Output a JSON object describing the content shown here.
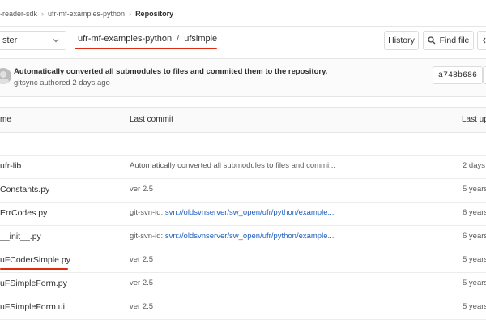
{
  "breadcrumb": {
    "items": [
      "-reader-sdk",
      "ufr-mf-examples-python",
      "Repository"
    ]
  },
  "toolbar": {
    "branch_value": "ster",
    "path": [
      "ufr-mf-examples-python",
      "ufsimple"
    ],
    "history_label": "History",
    "find_file_label": "Find file",
    "accent_underline": "#dd2b0e"
  },
  "commit": {
    "title": "Automatically converted all submodules to files and commited them to the repository.",
    "meta": "gitsync authored 2 days ago",
    "sha": "a748b686"
  },
  "table": {
    "headers": {
      "name": "me",
      "last_commit": "Last commit",
      "last_update": "Last up"
    },
    "rows": [
      {
        "name": "",
        "commit_text": "",
        "commit_link": "",
        "time": ""
      },
      {
        "name": "ufr-lib",
        "commit_text": "Automatically converted all submodules to files and commi...",
        "commit_link": "",
        "time": "2 days"
      },
      {
        "name": "Constants.py",
        "commit_text": "ver 2.5",
        "commit_link": "",
        "time": "5 years"
      },
      {
        "name": "ErrCodes.py",
        "commit_text": "git-svn-id: ",
        "commit_link": "svn://oldsvnserver/sw_open/ufr/python/example...",
        "time": "6 years"
      },
      {
        "name": "__init__.py",
        "commit_text": "git-svn-id: ",
        "commit_link": "svn://oldsvnserver/sw_open/ufr/python/example...",
        "time": "6 years"
      },
      {
        "name": "uFCoderSimple.py",
        "commit_text": "ver 2.5",
        "commit_link": "",
        "time": "5 years"
      },
      {
        "name": "uFSimpleForm.py",
        "commit_text": "ver 2.5",
        "commit_link": "",
        "time": "5 years"
      },
      {
        "name": "uFSimpleForm.ui",
        "commit_text": "ver 2.5",
        "commit_link": "",
        "time": "5 years"
      }
    ]
  }
}
